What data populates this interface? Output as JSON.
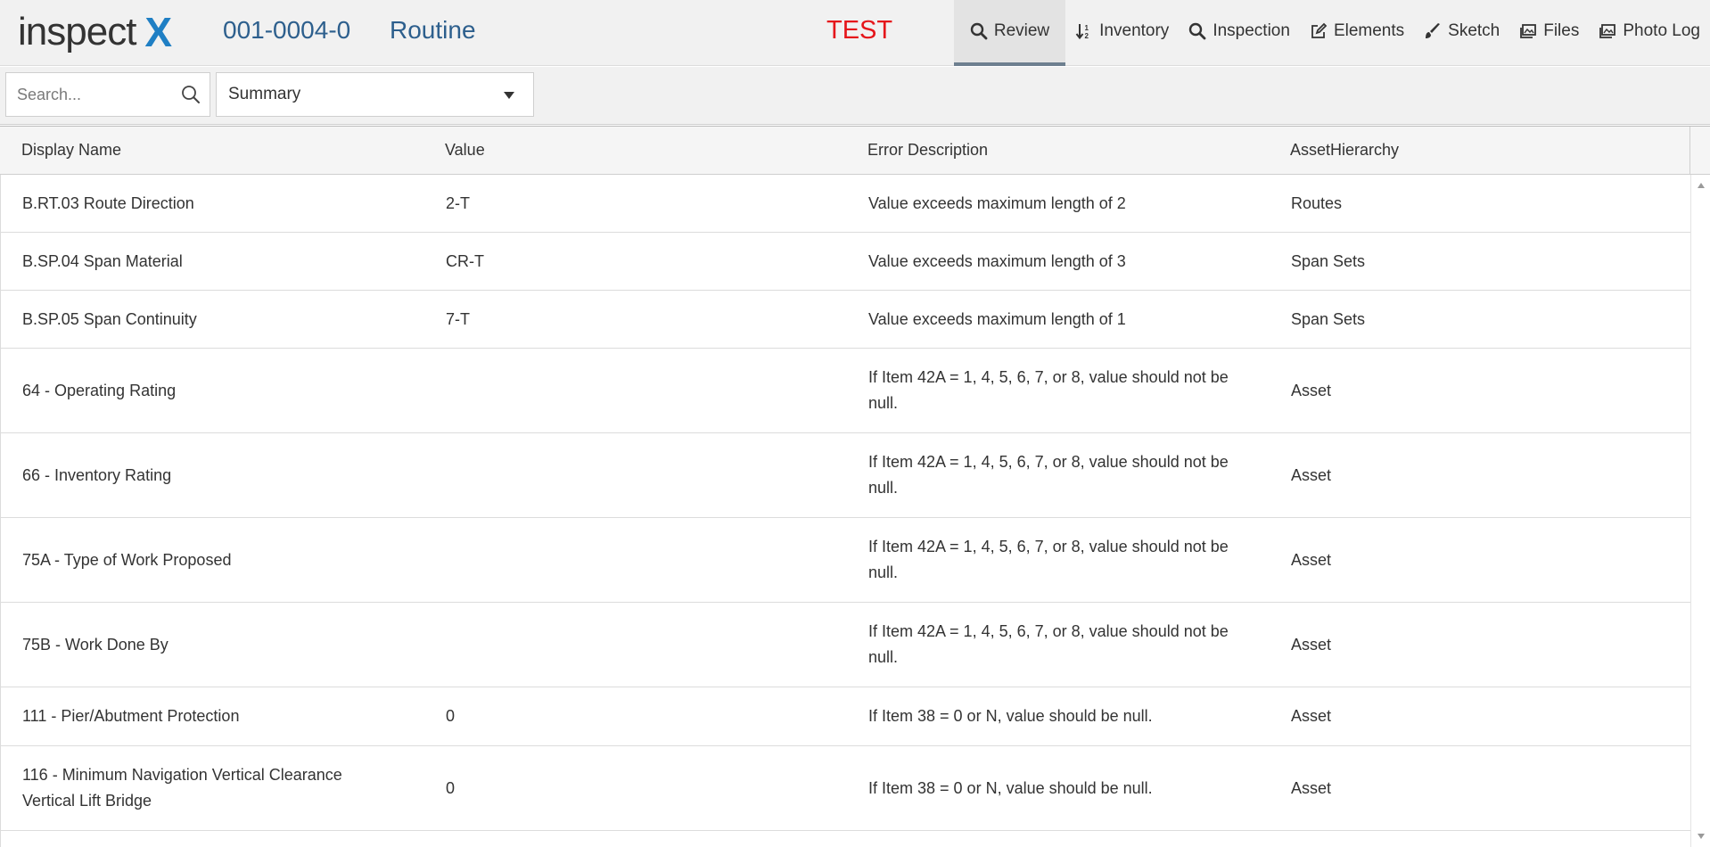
{
  "header": {
    "logo_text": "inspect",
    "logo_x": "X",
    "asset_id": "001-0004-0",
    "inspection_type": "Routine",
    "environment": "TEST"
  },
  "nav": {
    "review": "Review",
    "inventory": "Inventory",
    "inspection": "Inspection",
    "elements": "Elements",
    "sketch": "Sketch",
    "files": "Files",
    "photo_log": "Photo Log"
  },
  "toolbar": {
    "search_placeholder": "Search...",
    "view_selected": "Summary"
  },
  "table": {
    "columns": [
      "Display Name",
      "Value",
      "Error Description",
      "AssetHierarchy"
    ],
    "rows": [
      {
        "name": "B.RT.03 Route Direction",
        "value": "2-T",
        "error": "Value exceeds maximum length of 2",
        "hierarchy": "Routes"
      },
      {
        "name": "B.SP.04 Span Material",
        "value": "CR-T",
        "error": "Value exceeds maximum length of 3",
        "hierarchy": "Span Sets"
      },
      {
        "name": "B.SP.05 Span Continuity",
        "value": "7-T",
        "error": "Value exceeds maximum length of 1",
        "hierarchy": "Span Sets"
      },
      {
        "name": "64 - Operating Rating",
        "value": "",
        "error": "If Item 42A = 1, 4, 5, 6, 7, or 8, value should not be null.",
        "hierarchy": "Asset"
      },
      {
        "name": "66 - Inventory Rating",
        "value": "",
        "error": "If Item 42A = 1, 4, 5, 6, 7, or 8, value should not be null.",
        "hierarchy": "Asset"
      },
      {
        "name": "75A - Type of Work Proposed",
        "value": "",
        "error": "If Item 42A = 1, 4, 5, 6, 7, or 8, value should not be null.",
        "hierarchy": "Asset"
      },
      {
        "name": "75B - Work Done By",
        "value": "",
        "error": "If Item 42A = 1, 4, 5, 6, 7, or 8, value should not be null.",
        "hierarchy": "Asset"
      },
      {
        "name": "111 - Pier/Abutment Protection",
        "value": "0",
        "error": "If Item 38 = 0 or N, value should be null.",
        "hierarchy": "Asset"
      },
      {
        "name": "116 - Minimum Navigation Vertical Clearance Vertical Lift Bridge",
        "value": "0",
        "error": "If Item 38 = 0 or N, value should be null.",
        "hierarchy": "Asset"
      }
    ]
  },
  "colors": {
    "accent": "#2d5f8d",
    "logo_x": "#1f7fc4",
    "environment": "#e5161b"
  }
}
